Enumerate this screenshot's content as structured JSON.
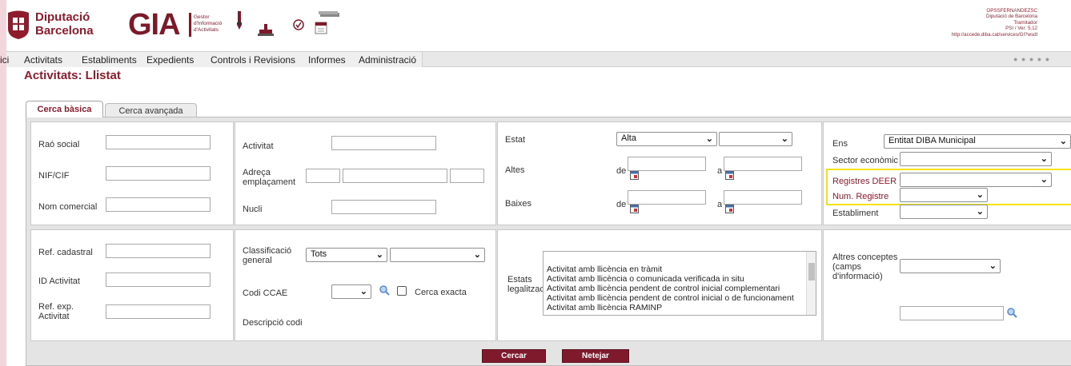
{
  "header": {
    "org_line1": "Diputació",
    "org_line2": "Barcelona",
    "app_acronym": "GIA",
    "app_sub1": "Gestor",
    "app_sub2": "d'Informació",
    "app_sub3": "d'Activitats",
    "user_lines": [
      "OPSSFERNANDEZSC",
      "Diputació de Barcelona",
      "Tramitador",
      "PSI / Ver: 5.12",
      "http://accede.diba.cat/services/GI?wsdl"
    ]
  },
  "menu": {
    "items": [
      "ici",
      "Activitats",
      "Establiments",
      "Expedients",
      "Controls i Revisions",
      "Informes",
      "Administració"
    ],
    "dots": "● ● ● ● ●"
  },
  "page_title": "Activitats: Llistat",
  "tabs": {
    "basic": "Cerca bàsica",
    "advanced": "Cerca avançada"
  },
  "panel1": {
    "rao_social": "Raó social",
    "nif": "NIF/CIF",
    "nom_comercial": "Nom comercial"
  },
  "panel2": {
    "activitat": "Activitat",
    "adreca1": "Adreça",
    "adreca2": "emplaçament",
    "nucli": "Nucli"
  },
  "panel3": {
    "estat": "Estat",
    "estat_value": "Alta",
    "altes": "Altes",
    "baixes": "Baixes",
    "de": "de",
    "a": "a"
  },
  "panel4": {
    "ens": "Ens",
    "ens_value": "Entitat DIBA Municipal",
    "sector": "Sector econòmic",
    "registres": "Registres DEER",
    "num_registre": "Num. Registre",
    "establiment": "Establiment"
  },
  "panel5": {
    "ref_cadastral": "Ref. cadastral",
    "id_activitat": "ID Activitat",
    "ref_exp1": "Ref. exp.",
    "ref_exp2": "Activitat"
  },
  "panel6": {
    "classificacio1": "Classificació",
    "classificacio2": "general",
    "classificacio_value": "Tots",
    "codi_ccae": "Codi CCAE",
    "cerca_exacta": "Cerca exacta",
    "descripcio": "Descripció codi"
  },
  "panel7": {
    "estats1": "Estats",
    "estats2": "legalització",
    "options": [
      "Activitat amb llicència en tràmit",
      "Activitat amb llicència o comunicada verificada in situ",
      "Activitat amb llicència pendent de control inicial complementari",
      "Activitat amb llicència pendent de control inicial o de funcionament",
      "Activitat amb llicència RAMINP"
    ]
  },
  "panel8": {
    "altres1": "Altres conceptes",
    "altres2": "(camps",
    "altres3": "d'informació)"
  },
  "buttons": {
    "search": "Cercar",
    "clear": "Netejar"
  },
  "colors": {
    "brand": "#7f1a2c",
    "highlight": "#f3e21a",
    "background": "#f2d6dc"
  }
}
